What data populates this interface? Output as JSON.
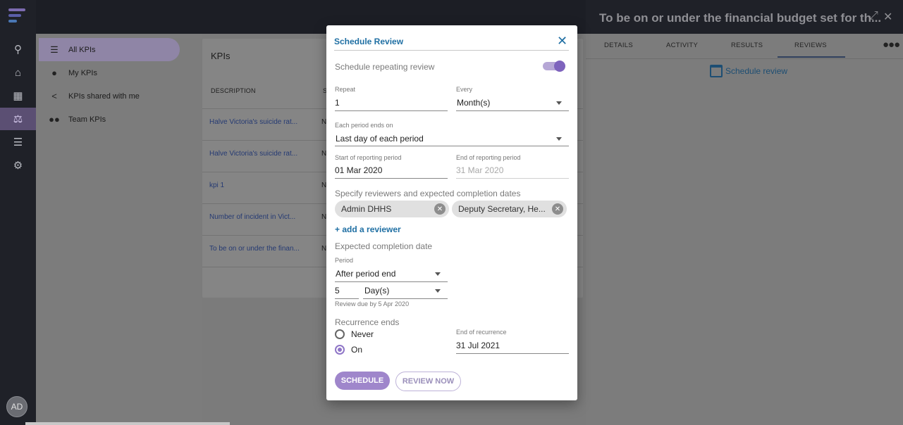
{
  "rail": {
    "avatar_initials": "AD",
    "icons": [
      "search-icon",
      "home-icon",
      "apps-icon",
      "balance-scale-icon",
      "report-icon",
      "settings-icon"
    ]
  },
  "nav": {
    "items": [
      {
        "label": "All KPIs",
        "icon": "list-icon"
      },
      {
        "label": "My KPIs",
        "icon": "person-icon"
      },
      {
        "label": "KPIs shared with me",
        "icon": "share-icon"
      },
      {
        "label": "Team KPIs",
        "icon": "people-icon"
      }
    ]
  },
  "list": {
    "title": "KPIs",
    "column_description": "DESCRIPTION",
    "column_second": "S",
    "rows": [
      {
        "description": "Halve Victoria's suicide rat...",
        "status": "N"
      },
      {
        "description": "Halve Victoria's suicide rat...",
        "status": "N"
      },
      {
        "description": "kpi 1",
        "status": "N"
      },
      {
        "description": "Number of incident in Vict...",
        "status": "N"
      },
      {
        "description": "To be on or under the finan...",
        "status": "N"
      }
    ]
  },
  "detail": {
    "title": "To be on or under the financial budget set for th...",
    "tabs": [
      "DETAILS",
      "ACTIVITY",
      "RESULTS",
      "REVIEWS"
    ],
    "active_tab": "REVIEWS",
    "schedule_link": "Schedule review"
  },
  "modal": {
    "title": "Schedule Review",
    "repeating_label": "Schedule repeating review",
    "repeating_on": true,
    "repeat_label": "Repeat",
    "repeat_value": "1",
    "every_label": "Every",
    "every_value": "Month(s)",
    "period_ends_label": "Each period ends on",
    "period_ends_value": "Last day of each period",
    "start_label": "Start of reporting period",
    "start_value": "01 Mar 2020",
    "end_label": "End of reporting period",
    "end_value": "31 Mar 2020",
    "reviewers_label": "Specify reviewers and expected completion dates",
    "reviewers": [
      "Admin DHHS",
      "Deputy Secretary, He..."
    ],
    "add_reviewer": "+ add a reviewer",
    "expected_label": "Expected completion date",
    "period_label": "Period",
    "period_value": "After period end",
    "days_value": "5",
    "days_unit": "Day(s)",
    "due_note": "Review due by 5 Apr 2020",
    "recurrence_label": "Recurrence ends",
    "never_label": "Never",
    "on_label": "On",
    "selected_option": "On",
    "end_recurrence_label": "End of recurrence",
    "end_recurrence_value": "31 Jul 2021",
    "schedule_button": "SCHEDULE",
    "review_now_button": "REVIEW NOW"
  },
  "colors": {
    "accent": "#9f86cb",
    "link": "#1f6fa3",
    "rail": "#1f2128"
  }
}
